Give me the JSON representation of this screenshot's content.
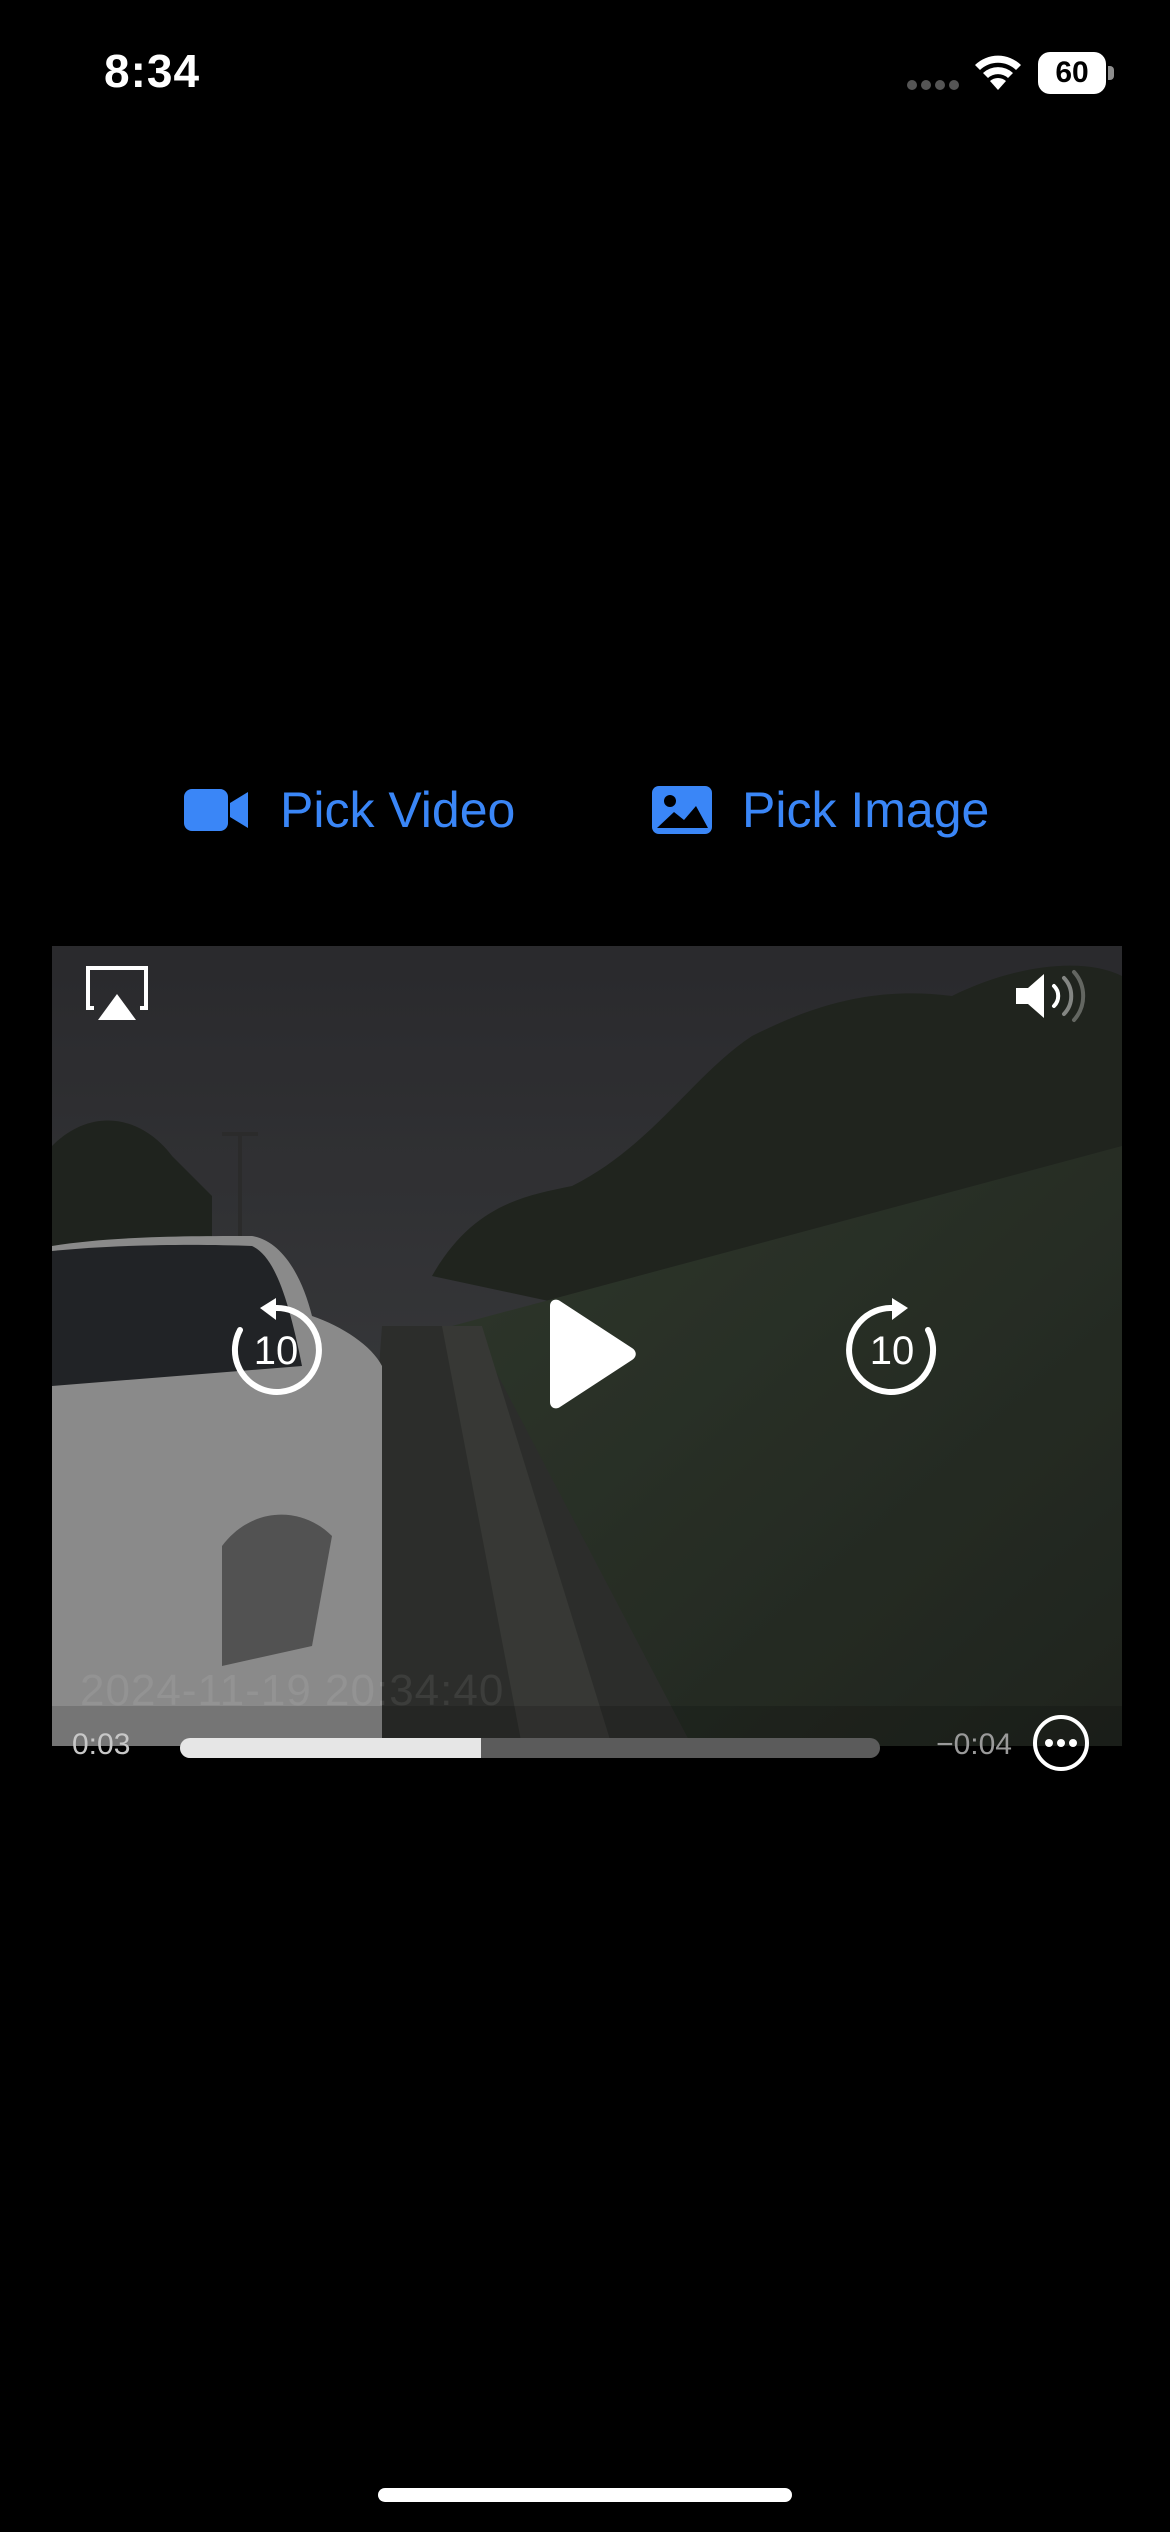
{
  "status_bar": {
    "time": "8:34",
    "battery_level": "60",
    "icons": [
      "cellular-signal-icon",
      "wifi-icon",
      "battery-icon"
    ]
  },
  "pickers": {
    "video": {
      "label": "Pick Video",
      "icon": "video-camera-icon"
    },
    "image": {
      "label": "Pick Image",
      "icon": "photo-icon"
    }
  },
  "player": {
    "elapsed": "0:03",
    "remaining": "−0:04",
    "progress_fraction": 0.43,
    "skip_back_seconds": "10",
    "skip_forward_seconds": "10",
    "frame_timestamp": "2024-11-19 20:34:40",
    "icons": [
      "airplay-icon",
      "volume-icon",
      "skip-back-icon",
      "play-icon",
      "skip-forward-icon",
      "more-icon"
    ]
  },
  "colors": {
    "accent": "#3a86f7",
    "background": "#000000",
    "scrubber_track": "#5b5b5b",
    "scrubber_fill": "#e6e6e6"
  }
}
